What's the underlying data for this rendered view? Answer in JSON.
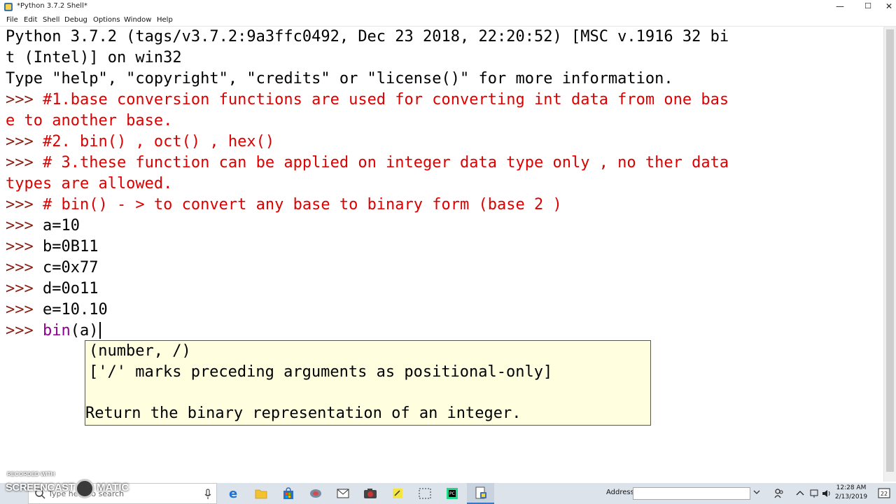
{
  "window": {
    "title": "*Python 3.7.2 Shell*",
    "minimize_glyph": "—",
    "maximize_glyph": "☐",
    "close_glyph": "✕"
  },
  "menu": [
    "File",
    "Edit",
    "Shell",
    "Debug",
    "Options",
    "Window",
    "Help"
  ],
  "shell": {
    "banner_1": "Python 3.7.2 (tags/v3.7.2:9a3ffc0492, Dec 23 2018, 22:20:52) [MSC v.1916 32 bi",
    "banner_2": "t (Intel)] on win32",
    "banner_3": "Type \"help\", \"copyright\", \"credits\" or \"license()\" for more information.",
    "prompt": ">>> ",
    "lines": [
      {
        "text": "#1.base conversion functions are used for converting int data from one bas"
      },
      {
        "text": "e to another base."
      },
      {
        "text": "#2. bin() , oct() , hex()"
      },
      {
        "text": "# 3.these function can be applied on integer data type only , no ther data"
      },
      {
        "text": "types are allowed."
      },
      {
        "text": "# bin() - > to convert any base to binary form (base 2 )"
      },
      {
        "text": "a=10"
      },
      {
        "text": "b=0B11"
      },
      {
        "text": "c=0x77"
      },
      {
        "text": "d=0o11"
      },
      {
        "text": "e=10.10"
      }
    ],
    "current_input_builtin": "bin",
    "current_input_rest": "(a)"
  },
  "calltip": {
    "signature": "(number, /)",
    "note": "['/' marks preceding arguments as positional-only]",
    "doc": "Return the binary representation of an integer."
  },
  "watermark": {
    "recorded_with": "RECORDED WITH",
    "left": "SCREENCAST",
    "right": "MATIC"
  },
  "taskbar": {
    "search_placeholder": "Type here to search",
    "address_label": "Address",
    "clock_time": "12:28 AM",
    "clock_date": "2/13/2019",
    "notification_count": "22",
    "colors": {
      "edge": "#1e73d6",
      "folder": "#f2c230",
      "store": "#2d6fc5",
      "pycharm": "#21d789"
    }
  }
}
